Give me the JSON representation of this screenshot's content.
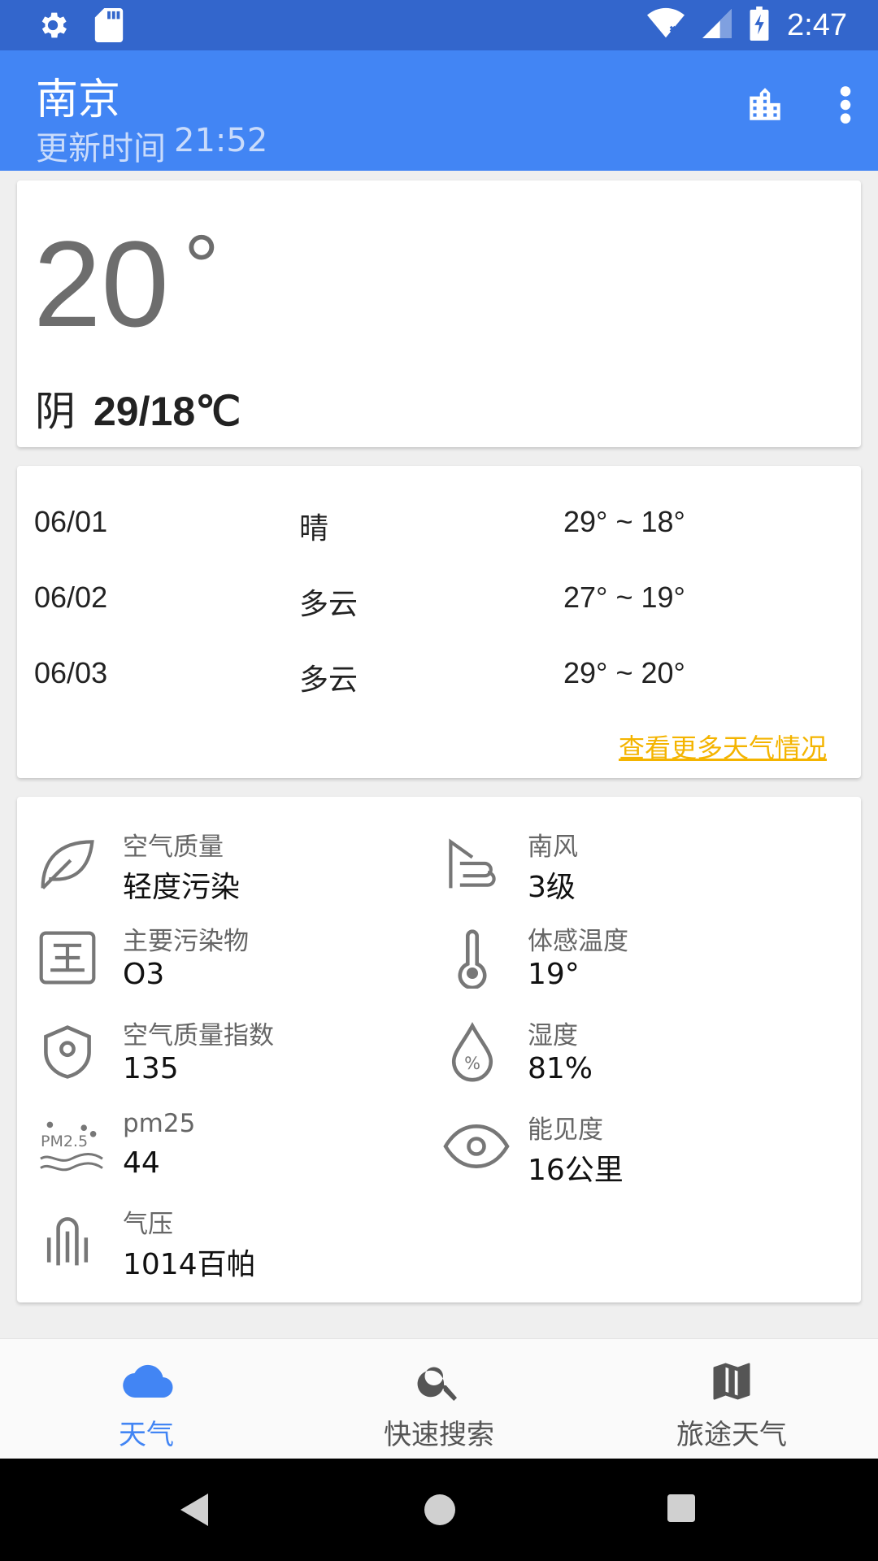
{
  "status_bar": {
    "time": "2:47",
    "icons": [
      "settings-icon",
      "sd-card-icon",
      "wifi-icon",
      "signal-icon",
      "battery-charging-icon"
    ]
  },
  "app_bar": {
    "city": "南京",
    "update_label": "更新时间",
    "update_time": "21:52",
    "actions": [
      "city-icon",
      "more-vert-icon"
    ]
  },
  "current": {
    "temperature": "20",
    "degree_symbol": "°",
    "condition": "阴",
    "range": "29/18℃"
  },
  "forecast": {
    "rows": [
      {
        "date": "06/01",
        "weather": "晴",
        "temps": "29° ~ 18°"
      },
      {
        "date": "06/02",
        "weather": "多云",
        "temps": "27° ~ 19°"
      },
      {
        "date": "06/03",
        "weather": "多云",
        "temps": "29° ~ 20°"
      }
    ],
    "more_link": "查看更多天气情况"
  },
  "details": [
    {
      "icon": "leaf-icon",
      "label": "空气质量",
      "value": "轻度污染"
    },
    {
      "icon": "wind-icon",
      "label": "南风",
      "value": "3级"
    },
    {
      "icon": "pollutant-icon",
      "label": "主要污染物",
      "value": "O3"
    },
    {
      "icon": "thermometer-icon",
      "label": "体感温度",
      "value": "19°"
    },
    {
      "icon": "shield-icon",
      "label": "空气质量指数",
      "value": "135"
    },
    {
      "icon": "humidity-icon",
      "label": "湿度",
      "value": "81%"
    },
    {
      "icon": "pm25-icon",
      "label": "pm25",
      "value": "44",
      "icon_text": "PM2.5"
    },
    {
      "icon": "eye-icon",
      "label": "能见度",
      "value": "16公里"
    },
    {
      "icon": "pressure-icon",
      "label": "气压",
      "value": "1014百帕"
    }
  ],
  "bottom_nav": [
    {
      "label": "天气",
      "icon": "cloud-icon",
      "active": true
    },
    {
      "label": "快速搜索",
      "icon": "search-icon",
      "active": false
    },
    {
      "label": "旅途天气",
      "icon": "map-icon",
      "active": false
    }
  ],
  "colors": {
    "status_bar": "#3366cc",
    "app_bar": "#4285f4",
    "accent_link": "#f4b400",
    "active_nav": "#4285f4"
  }
}
